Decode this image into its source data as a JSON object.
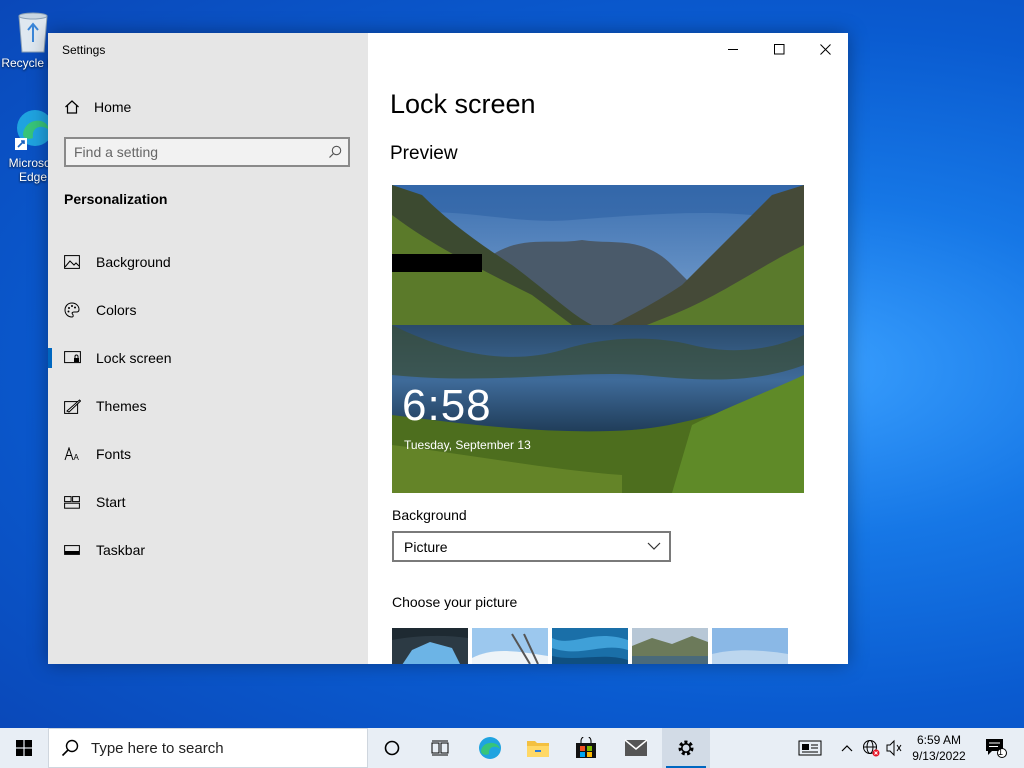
{
  "desktop": {
    "icons": [
      {
        "label": "Recycle Bin"
      },
      {
        "label": "Microsoft Edge"
      }
    ]
  },
  "window": {
    "title": "Settings",
    "home_label": "Home",
    "search_placeholder": "Find a setting",
    "section": "Personalization",
    "nav": [
      {
        "label": "Background",
        "icon": "picture-icon"
      },
      {
        "label": "Colors",
        "icon": "palette-icon"
      },
      {
        "label": "Lock screen",
        "icon": "lock-screen-icon",
        "active": true
      },
      {
        "label": "Themes",
        "icon": "themes-icon"
      },
      {
        "label": "Fonts",
        "icon": "fonts-icon"
      },
      {
        "label": "Start",
        "icon": "start-icon"
      },
      {
        "label": "Taskbar",
        "icon": "taskbar-icon"
      }
    ]
  },
  "content": {
    "title": "Lock screen",
    "preview_heading": "Preview",
    "preview_time": "6:58",
    "preview_date": "Tuesday, September 13",
    "background_label": "Background",
    "background_value": "Picture",
    "choose_label": "Choose your picture"
  },
  "taskbar": {
    "search_placeholder": "Type here to search",
    "time": "6:59 AM",
    "date": "9/13/2022",
    "notification_count": "1"
  },
  "colors": {
    "accent": "#0067c0",
    "sidebar": "#e6e6e6",
    "desktop": "#0a5bd0"
  }
}
